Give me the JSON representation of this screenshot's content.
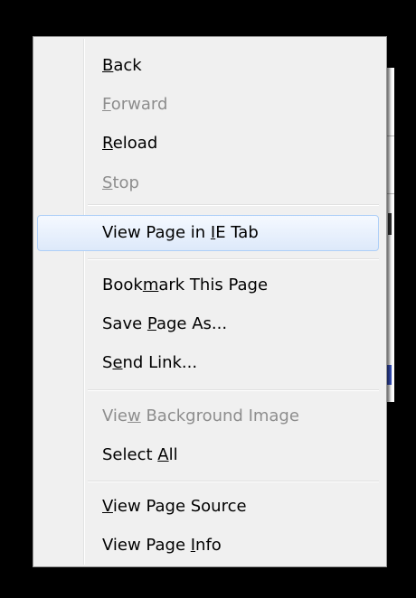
{
  "menu": {
    "items": [
      {
        "label": "Back",
        "mnemonic": "B",
        "enabled": true
      },
      {
        "label": "Forward",
        "mnemonic": "F",
        "enabled": false
      },
      {
        "label": "Reload",
        "mnemonic": "R",
        "enabled": true
      },
      {
        "label": "Stop",
        "mnemonic": "S",
        "enabled": false
      },
      {
        "label": "View Page in IE Tab",
        "mnemonic_index": 13,
        "enabled": true,
        "highlighted": true
      },
      {
        "label": "Bookmark This Page",
        "mnemonic_index": 4,
        "enabled": true
      },
      {
        "label": "Save Page As...",
        "mnemonic_index": 5,
        "enabled": true
      },
      {
        "label": "Send Link...",
        "mnemonic_index": 1,
        "enabled": true
      },
      {
        "label": "View Background Image",
        "mnemonic_index": 3,
        "enabled": false
      },
      {
        "label": "Select All",
        "mnemonic_index": 7,
        "enabled": true
      },
      {
        "label": "View Page Source",
        "mnemonic_index": 0,
        "enabled": true
      },
      {
        "label": "View Page Info",
        "mnemonic_index": 10,
        "enabled": true
      }
    ]
  },
  "colors": {
    "menu_background": "#f0f0f0",
    "disabled_text": "#8d8d8d",
    "highlight_border": "#aecff7",
    "highlight_fill": "#dde9fa"
  }
}
